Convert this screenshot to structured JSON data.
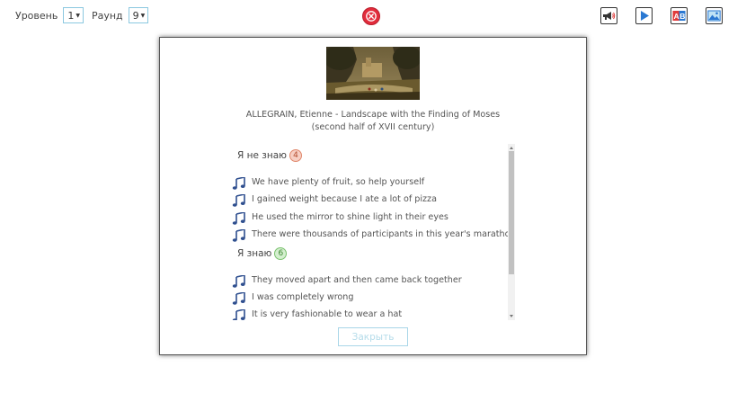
{
  "topbar": {
    "level_label": "Уровень",
    "level_value": "1",
    "round_label": "Раунд",
    "round_value": "9"
  },
  "icons": {
    "close": "close-icon",
    "tools": [
      "megaphone-icon",
      "play-icon",
      "ab-icon",
      "picture-icon"
    ]
  },
  "modal": {
    "caption_line1": "ALLEGRAIN, Etienne - Landscape with the Finding of Moses",
    "caption_line2": "(second half of XVII century)",
    "unknown_label": "Я не знаю",
    "unknown_count": "4",
    "unknown_items": [
      "We have plenty of fruit, so help yourself",
      "I gained weight because I ate a lot of pizza",
      "He used the mirror to shine light in their eyes",
      "There were thousands of participants in this year's marathon"
    ],
    "known_label": "Я знаю",
    "known_count": "6",
    "known_items": [
      "They moved apart and then came back together",
      "I was completely wrong",
      "It is very fashionable to wear a hat"
    ],
    "close_label": "Закрыть"
  },
  "colors": {
    "accent_close": "#e22c3c",
    "unknown_badge": "#f7cfc3",
    "known_badge": "#d4efcf",
    "note_icon": "#2f4f8f",
    "button_border": "#a9d6e8"
  }
}
